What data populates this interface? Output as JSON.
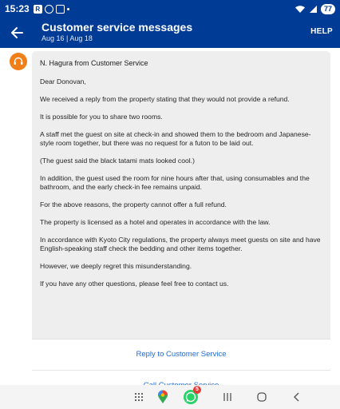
{
  "status_bar": {
    "time": "15:23",
    "icons": [
      "r-icon",
      "whatsapp-icon",
      "image-icon",
      "dot-icon"
    ],
    "battery": "77"
  },
  "app_bar": {
    "title": "Customer service messages",
    "subtitle": "Aug 16 | Aug 18",
    "help_label": "HELP"
  },
  "message": {
    "sender": "N. Hagura from Customer Service",
    "paragraphs": [
      "Dear Donovan,",
      "We received a reply from the property stating that they would not provide a refund.",
      "It is possible for you to share two rooms.",
      "A staff met the guest on site at check-in and showed them to the bedroom and Japanese-style room together, but there was no request for a futon to be laid out.",
      "(The guest said the black tatami mats looked cool.)",
      "In addition, the guest used the room for nine hours after that, using consumables and the bathroom, and the early check-in fee remains unpaid.",
      "For the above reasons, the property cannot offer a full refund.",
      "The property is licensed as a hotel and operates in accordance with the law.",
      "In accordance with Kyoto City regulations, the property always meet guests on site and have English-speaking staff check the bedding and other items together.",
      "However, we deeply regret this misunderstanding.",
      "If you have any other questions, please feel free to contact us."
    ]
  },
  "actions": {
    "reply_label": "Reply to Customer Service",
    "call_label": "Call Customer Service"
  },
  "nav": {
    "whatsapp_badge": "5"
  },
  "colors": {
    "brand_blue": "#003b95",
    "link_blue": "#1d6ad6",
    "avatar_orange": "#f07f1a"
  }
}
